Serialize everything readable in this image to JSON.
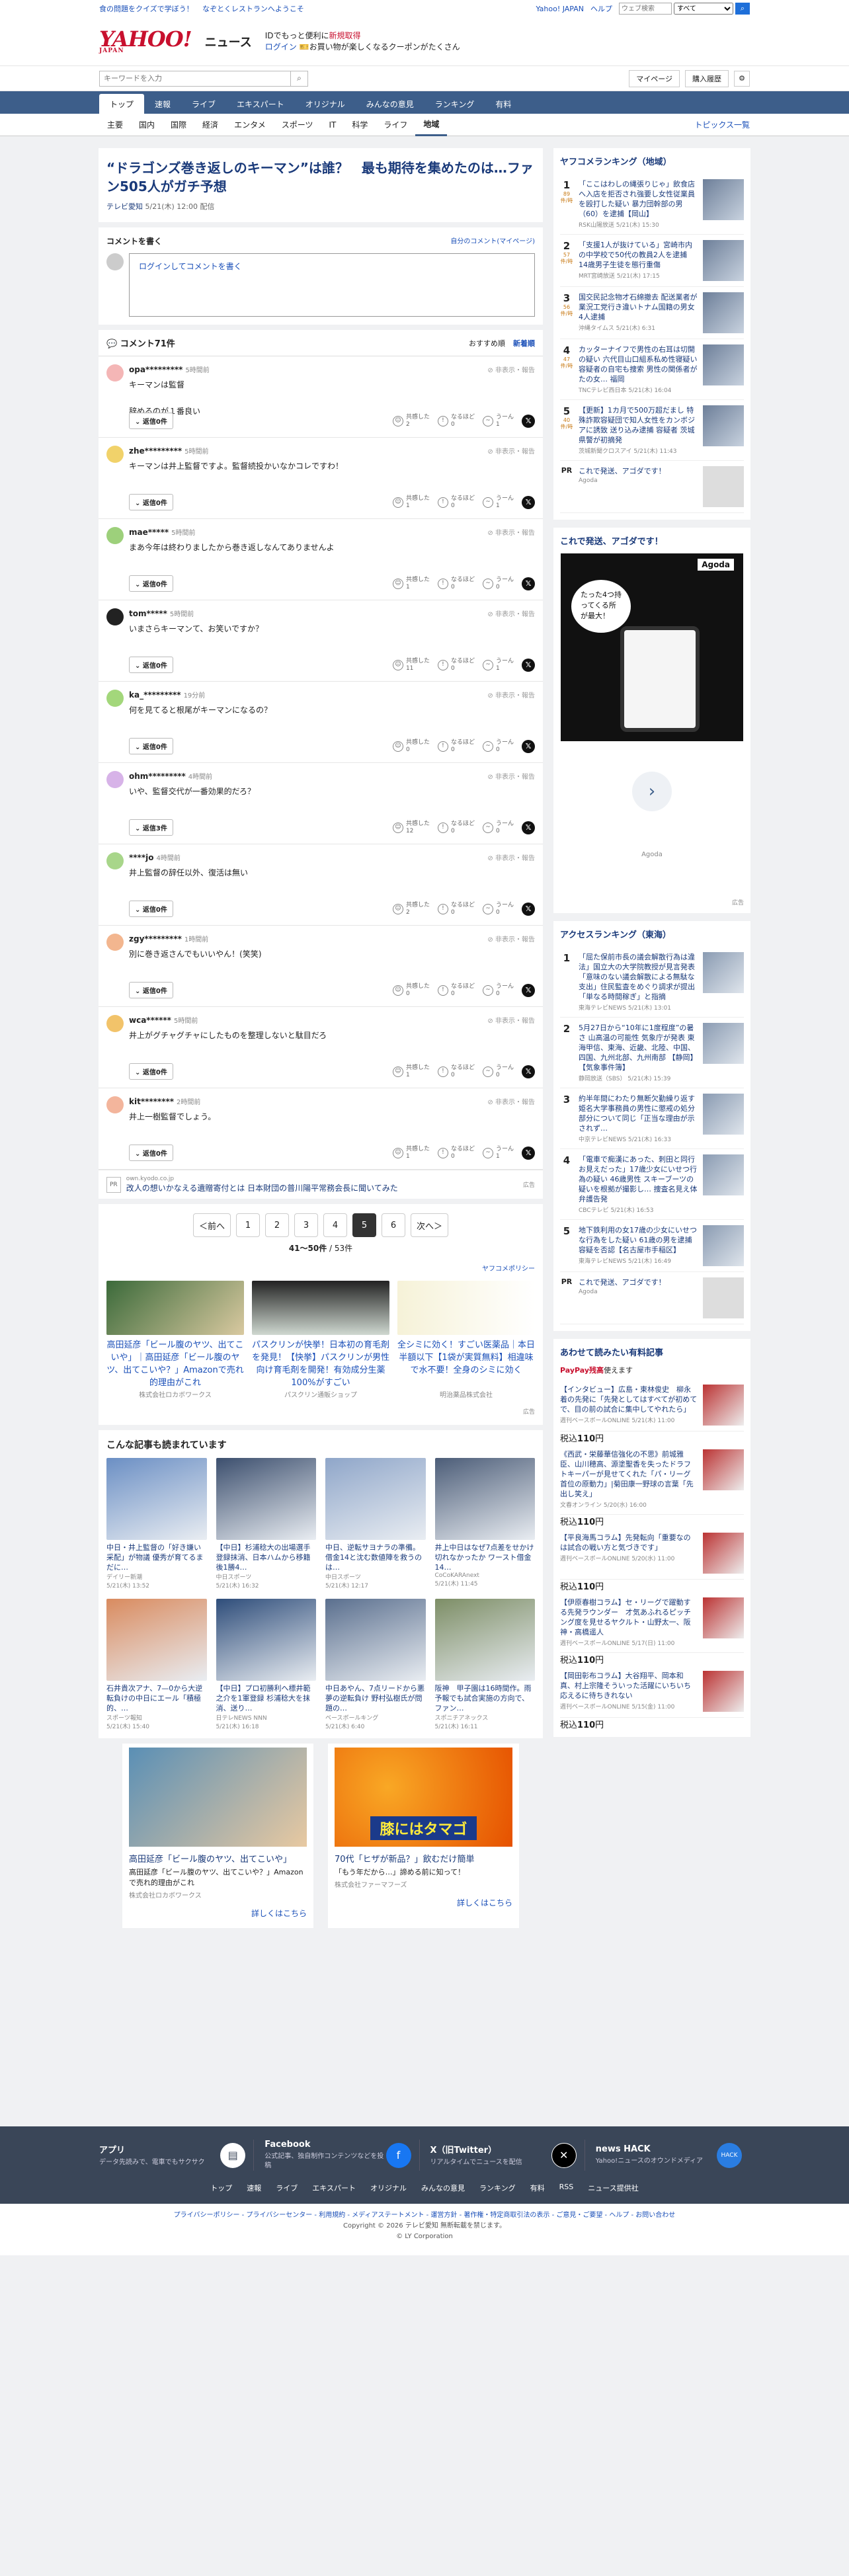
{
  "top": {
    "promo1": "食の問題をクイズで学ぼう！",
    "promo2": "なぞとくレストランへようこそ",
    "links": [
      "Yahoo! JAPAN",
      "ヘルプ"
    ],
    "search_placeholder": "ウェブ検索",
    "search_scope": "すべて",
    "search_button": "検索"
  },
  "masthead": {
    "logo": "YAHOO!",
    "logo_sub": "JAPAN",
    "site": "ニュース",
    "promo_line1": "IDでもっと便利に",
    "promo_line1_red": "新規取得",
    "login": "ログイン",
    "promo_line2": "お買い物が楽しくなるクーポンがたくさん"
  },
  "search": {
    "placeholder": "キーワードを入力",
    "mypage": "マイページ",
    "history": "購入履歴"
  },
  "nav": {
    "categories": [
      "トップ",
      "速報",
      "ライブ",
      "エキスパート",
      "オリジナル",
      "みんなの意見",
      "ランキング",
      "有料"
    ],
    "sub": [
      "主要",
      "国内",
      "国際",
      "経済",
      "エンタメ",
      "スポーツ",
      "IT",
      "科学",
      "ライフ",
      "地域"
    ],
    "topics": "トピックス一覧"
  },
  "article": {
    "title": "“ドラゴンズ巻き返しのキーマン”は誰？　最も期待を集めたのは…ファン505人がガチ予想",
    "source": "テレビ愛知",
    "date": "5/21(木) 12:00 配信"
  },
  "comment_form": {
    "heading": "コメントを書く",
    "my_comments": "自分のコメント(マイページ)",
    "placeholder": "ログインしてコメントを書く"
  },
  "comments_header": {
    "count": "コメント71件",
    "sort1": "おすすめ順",
    "sort2": "新着順"
  },
  "comments": [
    {
      "user": "opa*********",
      "time": "5時間前",
      "text": "キーマンは監督\n\n辞めるのが１番良い",
      "reply": "返信0件",
      "r1": "2",
      "r2": "0",
      "r3": "1",
      "color": "#f4b6b6"
    },
    {
      "user": "zhe*********",
      "time": "5時間前",
      "text": "キーマンは井上監督ですよ。監督続投かいなかコレですわ！",
      "reply": "返信0件",
      "r1": "1",
      "r2": "0",
      "r3": "1",
      "color": "#f1d26a"
    },
    {
      "user": "mae*****",
      "time": "5時間前",
      "text": "まあ今年は終わりましたから巻き返しなんてありませんよ",
      "reply": "返信0件",
      "r1": "1",
      "r2": "0",
      "r3": "0",
      "color": "#9dd07b"
    },
    {
      "user": "tom*****",
      "time": "5時間前",
      "text": "いまさらキーマンて、お笑いですか？",
      "reply": "返信0件",
      "r1": "11",
      "r2": "0",
      "r3": "1",
      "color": "#222222"
    },
    {
      "user": "ka_*********",
      "time": "19分前",
      "text": "何を見てると根尾がキーマンになるの？",
      "reply": "返信0件",
      "r1": "0",
      "r2": "0",
      "r3": "0",
      "color": "#a3d77b"
    },
    {
      "user": "ohm*********",
      "time": "4時間前",
      "text": "いや、監督交代が一番効果的だろ？",
      "reply": "返信3件",
      "r1": "12",
      "r2": "0",
      "r3": "0",
      "color": "#d7b3e8"
    },
    {
      "user": "****jo",
      "time": "4時間前",
      "text": "井上監督の辞任以外、復活は無い",
      "reply": "返信0件",
      "r1": "2",
      "r2": "0",
      "r3": "0",
      "color": "#a8d68a"
    },
    {
      "user": "zgy*********",
      "time": "1時間前",
      "text": "別に巻き返さんでもいいやん！(笑笑)",
      "reply": "返信0件",
      "r1": "0",
      "r2": "0",
      "r3": "0",
      "color": "#f3b68f"
    },
    {
      "user": "wca******",
      "time": "5時間前",
      "text": "井上がグチャグチャにしたものを整理しないと駄目だろ",
      "reply": "返信0件",
      "r1": "1",
      "r2": "0",
      "r3": "0",
      "color": "#f2c36a"
    },
    {
      "user": "kit********",
      "time": "2時間前",
      "text": "井上一樹監督でしょう。",
      "reply": "返信0件",
      "r1": "1",
      "r2": "0",
      "r3": "1",
      "color": "#f3b59c"
    }
  ],
  "reactions": {
    "a": "共感した",
    "b": "なるほど",
    "c": "うーん",
    "options": "非表示・報告"
  },
  "inline_ad": {
    "label": "PR",
    "source": "own.kyodo.co.jp",
    "title": "改人の想いかなえる遺贈寄付とは 日本財団の普川陽平常務会長に聞いてみた",
    "mark": "広告"
  },
  "pager": {
    "prev": "＜前へ",
    "pages": [
      "1",
      "2",
      "3",
      "4",
      "5",
      "6"
    ],
    "current": "5",
    "next": "次へ＞",
    "range": "41〜50件",
    "total": "53件"
  },
  "policy": "ヤフコメポリシー",
  "ads": [
    {
      "title": "高田延彦「ビール腹のヤツ、出てこいや」｜高田延彦「ビール腹のヤツ、出てこいや？」Amazonで売れ的理由がこれ",
      "adv": "株式会社ロカボワークス"
    },
    {
      "title": "パスクリンが快挙！日本初の育毛剤を発見！【快挙】パスクリンが男性向け育毛剤を開発！有効成分生薬100%がすごい",
      "adv": "パスクリン通販ショップ"
    },
    {
      "title": "全シミに効く！すごい医薬品｜本日半額以下【1袋が実質無料】相違味で水不要！全身のシミに効く",
      "adv": "明治薬品株式会社"
    }
  ],
  "ads_mark": "広告",
  "read": {
    "heading": "こんな記事も読まれています",
    "items": [
      {
        "title": "中日・井上監督の「好き嫌い采配」が物議 優秀が育てるまだに…",
        "src": "デイリー新潮",
        "time": "5/21(木) 13:52"
      },
      {
        "title": "【中日】杉浦稔大の出場選手登録抹消、日本ハムから移籍後1勝4…",
        "src": "中日スポーツ",
        "time": "5/21(木) 16:32"
      },
      {
        "title": "中日、逆転サヨナラの準備。借金14と沈む数値陣を救うのは…",
        "src": "中日スポーツ",
        "time": "5/21(木) 12:17"
      },
      {
        "title": "井上中日はなぜ7点差をせかけ切れなかったか ワースト借金14…",
        "src": "CoCoKARAnext",
        "time": "5/21(木) 11:45"
      },
      {
        "title": "石井貴次アナ、7—0から大逆転負けの中日にエール「積極的、…",
        "src": "スポーツ報知",
        "time": "5/21(木) 15:40"
      },
      {
        "title": "【中日】プロ初勝利へ標井範之介を1軍登録 杉浦稔大を抹消、送り…",
        "src": "日テレNEWS NNN",
        "time": "5/21(木) 16:18"
      },
      {
        "title": "中日あやん、7点リードから悪夢の逆転負け 野村弘樹氏が問題の…",
        "src": "ベースボールキング",
        "time": "5/21(木) 6:40"
      },
      {
        "title": "阪神　甲子園は16時間作。雨予報でも試合実施の方向で、ファン…",
        "src": "スポニチアネックス",
        "time": "5/21(木) 16:11"
      }
    ]
  },
  "bottom_ads": [
    {
      "title": "高田延彦「ビール腹のヤツ、出てこいや」",
      "desc": "高田延彦「ビール腹のヤツ、出てこいや？」Amazonで売れ的理由がこれ",
      "adv": "株式会社ロカボワークス",
      "more": "詳しくはこちら"
    },
    {
      "title": "70代「ヒザが新品？」飲むだけ簡単",
      "desc": "「もう年だから…」諦める前に知って！",
      "adv": "株式会社ファーマフーズ",
      "more": "詳しくはこちら",
      "banner": "膝にはタマゴ"
    }
  ],
  "side_rank": {
    "heading": "ヤフコメランキング（地域）",
    "items": [
      {
        "n": "1",
        "cnt": "89",
        "unit": "件/時",
        "title": "「ここはわしの縄張りじゃ」飲食店へ入店を拒否され強要し女性従業員を殴打した疑い 暴力団幹部の男（60）を逮捕【岡山】",
        "src": "RSK山陽放送 5/21(木) 15:30"
      },
      {
        "n": "2",
        "cnt": "57",
        "unit": "件/時",
        "title": "「支援1人が抜けている」宮崎市内の中学校で50代の教員2人を逮捕 14歳男子生徒を態行重傷",
        "src": "MRT宮崎放送 5/21(木) 17:15"
      },
      {
        "n": "3",
        "cnt": "56",
        "unit": "件/時",
        "title": "国交民記念物才石綿撤去 配送業者が業況工党行き違いトナム国籍の男女4人逮捕",
        "src": "沖縄タイムス 5/21(木) 6:31"
      },
      {
        "n": "4",
        "cnt": "47",
        "unit": "件/時",
        "title": "カッターナイフで男性の右耳は切開の疑い 六代目山口組系私め性寝疑い容疑者の自宅も捜索 男性の関係者がたの女… 福岡",
        "src": "TNCテレビ西日本 5/21(木) 16:04"
      },
      {
        "n": "5",
        "cnt": "40",
        "unit": "件/時",
        "title": "【更新】1カ月で500万超だまし 特殊詐欺容疑団で知人女性をカンボジアに誘致 送り込み逮捕 容疑者 茨城県警が初摘発",
        "src": "茨城新聞クロスアイ 5/21(木) 11:43"
      }
    ],
    "pr": {
      "label": "PR",
      "title": "これで発送、アゴダです！",
      "src": "Agoda"
    }
  },
  "side_ad": {
    "heading": "これで発送、アゴダです！",
    "brand": "Agoda",
    "bubble": "たった4つ持ってくる所が最大！",
    "mark": "広告"
  },
  "access_rank": {
    "heading": "アクセスランキング（東海）",
    "items": [
      {
        "n": "1",
        "title": "「屈た保前市長の議会解散行為は違法」国立大の大学院教授が見言発表「意味のない議会解散による無駄な支出」住民監査をめぐり調求が提出「単なる時間稼ぎ」と指摘",
        "src": "東海テレビNEWS 5/21(木) 13:01"
      },
      {
        "n": "2",
        "title": "5月27日から“10年に1度程度”の暑さ 山高温の可能性 気象庁が発表 東海甲信、東海、近畿、北陸、中国、四国、九州北部、九州南部 【静岡】【気象事件簿】",
        "src": "静岡放送（SBS） 5/21(木) 15:39"
      },
      {
        "n": "3",
        "title": "約半年間にわたり無断欠勤繰り返す　姫名大学事務員の男性に懲戒の処分 部分について同じ「正当な理由が示されず…",
        "src": "中京テレビNEWS 5/21(木) 16:33"
      },
      {
        "n": "4",
        "title": "「電車で痴漢にあった、刺田と同行お見えだった」17歳少女にいせつ行為の疑い 46歳男性 スキーブーツの疑いを根拠が撮影し… 捜査名見え体弁護告発",
        "src": "CBCテレビ 5/21(木) 16:53"
      },
      {
        "n": "5",
        "title": "地下鉄利用の女17歳の少女にいせつな行為をした疑い 61歳の男を逮捕　容疑を否認【名古屋市手稲区】",
        "src": "東海テレビNEWS 5/21(木) 16:49"
      }
    ],
    "pr": {
      "label": "PR",
      "title": "これで発送、アゴダです！",
      "src": "Agoda"
    }
  },
  "paid": {
    "heading": "あわせて読みたい有料記事",
    "paypay": "PayPay残高",
    "paypay_suffix": "使えます",
    "price_prefix": "税込",
    "items": [
      {
        "title": "【インタビュー】広島・東林俊史　柳永着の先発に「先発としてはすべてが初めてで、目の前の試合に集中してやれたら」",
        "src": "週刊ベースボールONLINE 5/21(木) 11:00",
        "price": "110"
      },
      {
        "title": "《西武・栄藤華信強化の不思》前城雅臣、山川穂高、源塗聖香を失ったドラフトキーパーが見せてくれた「パ・リーグ首位の原動力」|菊田康一野球の言葉「先出し笑え」",
        "src": "文春オンライン 5/20(水) 16:00",
        "price": "110"
      },
      {
        "title": "【平良海馬コラム】先発転向「重要なのは試合の戦い方と気づきです」",
        "src": "週刊ベースボールONLINE 5/20(水) 11:00",
        "price": "110"
      },
      {
        "title": "【伊原春樹コラム】セ・リーグで躍動する先発ラウンダー　才気あふれるピッチング度を見せるヤクルト・山野太一、阪神・高橋遥人",
        "src": "週刊ベースボールONLINE 5/17(日) 11:00",
        "price": "110"
      },
      {
        "title": "【岡田彰布コラム】大谷翔平、岡本和真、村上宗隆そういった活躍にいちいち応えるに待ちきれない",
        "src": "週刊ベースボールONLINE 5/15(金) 11:00",
        "price": "110"
      }
    ]
  },
  "footer": {
    "cards": [
      {
        "name": "アプリ",
        "desc": "データ先読みで、電車でもサクサク"
      },
      {
        "name": "Facebook",
        "desc": "公式記事、独自制作コンテンツなどを投稿"
      },
      {
        "name": "X（旧Twitter）",
        "desc": "リアルタイムでニュースを配信"
      },
      {
        "name": "news HACK",
        "desc": "Yahoo!ニュースのオウンドメディア"
      }
    ],
    "nav": [
      "トップ",
      "速報",
      "ライブ",
      "エキスパート",
      "オリジナル",
      "みんなの意見",
      "ランキング",
      "有料",
      "RSS",
      "ニュース提供社"
    ],
    "legal": "プライバシーポリシー - プライバシーセンター - 利用規約 - メディアステートメント - 運営方針 - 著作権・特定商取引法の表示 - ご意見・ご要望 - ヘルプ - お問い合わせ",
    "copyright": "Copyright © 2026 テレビ愛知 無断転載を禁じます。",
    "corp": "© LY Corporation"
  }
}
